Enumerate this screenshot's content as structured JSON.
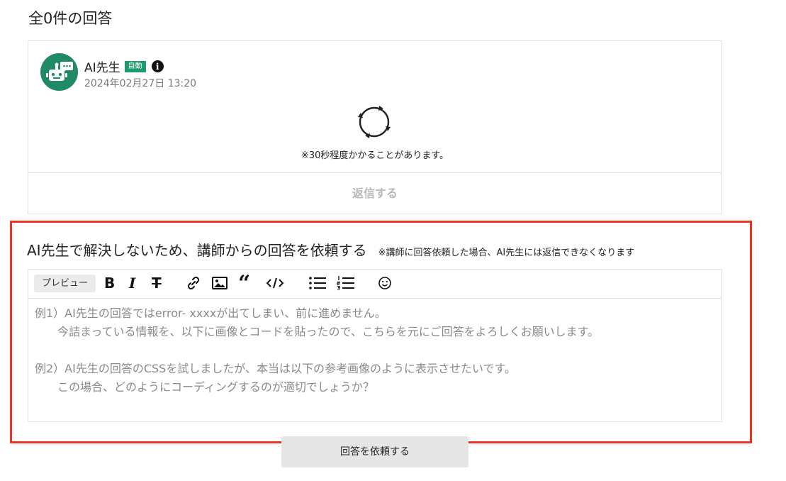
{
  "answers": {
    "heading": "全0件の回答"
  },
  "ai_answer": {
    "author_name": "AI先生",
    "badge": "自動",
    "timestamp": "2024年02月27日 13:20",
    "wait_note": "※30秒程度かかることがあります。",
    "reply_label": "返信する",
    "icons": [
      "robot-avatar-icon",
      "info-icon",
      "loading-refresh-icon"
    ]
  },
  "request": {
    "title": "AI先生で解決しないため、講師からの回答を依頼する",
    "note": "※講師に回答依頼した場合、AI先生には返信できなくなります",
    "toolbar": {
      "preview_label": "プレビュー",
      "bold_glyph": "B",
      "italic_glyph": "I",
      "strike_glyph": "T",
      "quote_glyph": "“",
      "icons": [
        "bold-icon",
        "italic-icon",
        "strikethrough-icon",
        "link-icon",
        "image-icon",
        "quote-icon",
        "code-icon",
        "bullet-list-icon",
        "numbered-list-icon",
        "emoji-icon"
      ]
    },
    "placeholder": "例1）AI先生の回答ではerror- xxxxが出てしまい、前に進めません。\n　　今詰まっている情報を、以下に画像とコードを貼ったので、こちらを元にご回答をよろしくお願いします。\n\n例2）AI先生の回答のCSSを試しましたが、本当は以下の参考画像のように表示させたいです。\n　　この場合、どのようにコーディングするのが適切でしょうか？",
    "submit_label": "回答を依頼する"
  },
  "colors": {
    "accent_green": "#1f8a64",
    "highlight_red": "#ea3323"
  }
}
